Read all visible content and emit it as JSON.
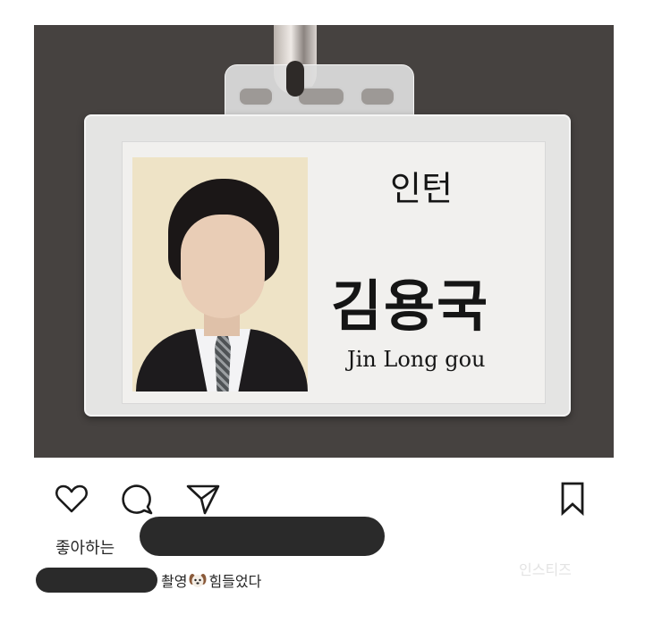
{
  "badge": {
    "role": "인턴",
    "name_korean": "김용국",
    "name_english": "Jin Long gou"
  },
  "actions": {
    "like_icon": "heart-outline-icon",
    "comment_icon": "speech-bubble-icon",
    "share_icon": "paper-plane-icon",
    "save_icon": "bookmark-icon"
  },
  "likes": {
    "label": "좋아하는"
  },
  "caption": {
    "before_emoji": "촬영",
    "emoji_icon": "puppy-face-icon",
    "after_emoji": "힘들었다"
  },
  "watermark": {
    "text": "인스티즈"
  },
  "colors": {
    "background": "#ffffff",
    "photo_backdrop": "#464240",
    "redaction": "#2a2a2a",
    "text": "#262626"
  }
}
